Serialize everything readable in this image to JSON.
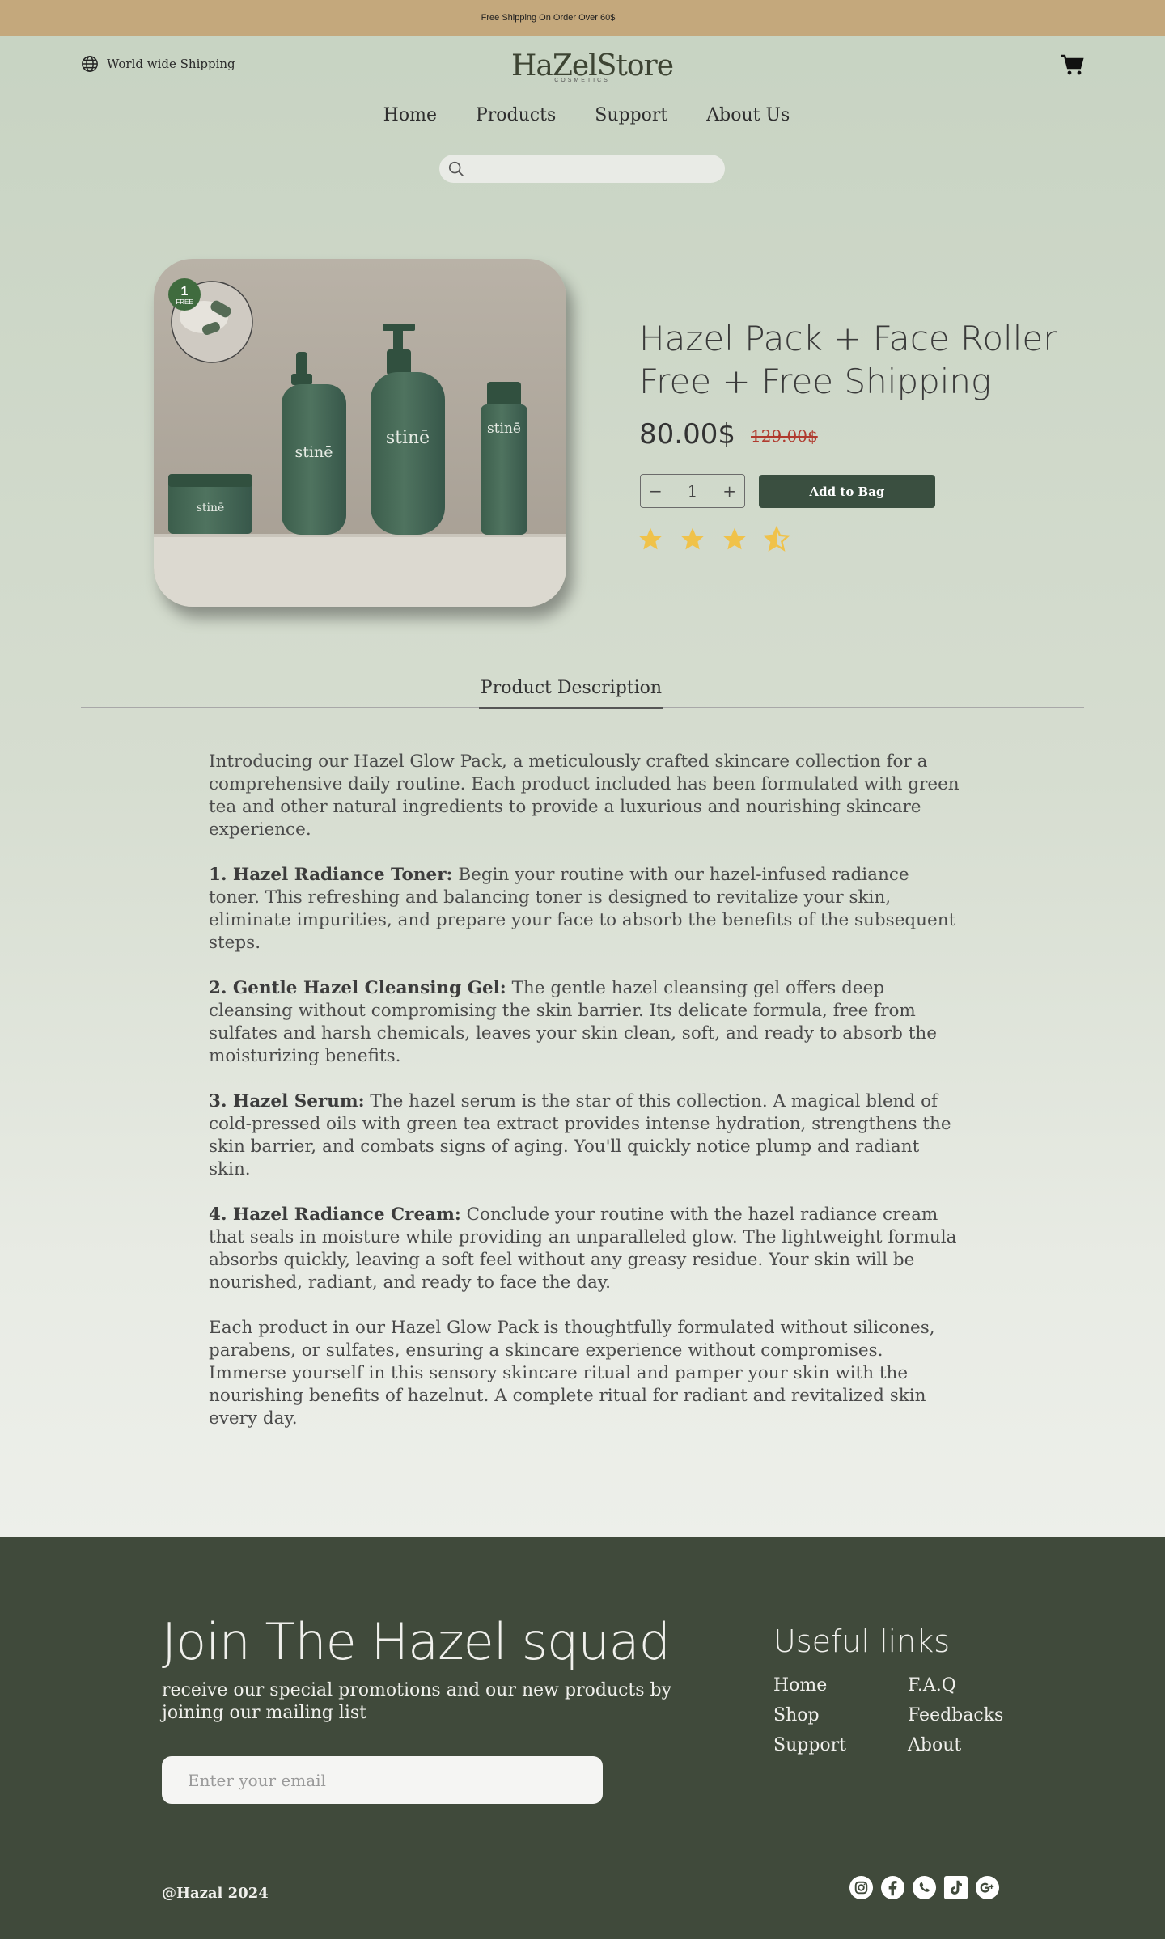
{
  "announcement": "Free Shipping On Order Over 60$",
  "header": {
    "shipping_label": "World wide Shipping",
    "logo_name": "HaZelStore",
    "logo_sub": "COSMETICS"
  },
  "nav": [
    "Home",
    "Products",
    "Support",
    "About Us"
  ],
  "search": {
    "placeholder": ""
  },
  "product": {
    "title": "Hazel Pack + Face Roller Free + Free Shipping",
    "price": "80.00$",
    "old_price": "129.00$",
    "quantity": "1",
    "minus": "−",
    "plus": "+",
    "add_to_bag": "Add to Bag",
    "rating": 3.5,
    "badge_number": "1",
    "badge_text": "FREE",
    "brand_label": "stinē"
  },
  "tabs": {
    "description": "Product Description"
  },
  "description": {
    "intro": "Introducing our Hazel Glow Pack, a meticulously crafted skincare collection for a comprehensive daily routine. Each product included has been formulated with green tea and other natural ingredients to provide a luxurious and nourishing skincare experience.",
    "items": [
      {
        "heading": "1. Hazel Radiance Toner:",
        "text": " Begin your routine with our hazel-infused radiance toner. This refreshing and balancing toner is designed to revitalize your skin, eliminate impurities, and prepare your face to absorb the benefits of the subsequent steps."
      },
      {
        "heading": "2. Gentle Hazel Cleansing Gel:",
        "text": " The gentle hazel cleansing gel offers deep cleansing without compromising the skin barrier. Its delicate formula, free from sulfates and harsh chemicals, leaves your skin clean, soft, and ready to absorb the moisturizing benefits."
      },
      {
        "heading": "3. Hazel Serum:",
        "text": " The hazel serum is the star of this collection. A magical blend of cold-pressed oils with green tea extract provides intense hydration, strengthens the skin barrier, and combats signs of aging. You'll quickly notice plump and radiant skin."
      },
      {
        "heading": "4. Hazel Radiance Cream:",
        "text": " Conclude your routine with the hazel radiance cream that seals in moisture while providing an unparalleled glow. The lightweight formula absorbs quickly, leaving a soft feel without any greasy residue. Your skin will be nourished, radiant, and ready to face the day."
      }
    ],
    "outro": "Each product in our Hazel Glow Pack is thoughtfully formulated without silicones, parabens, or sulfates, ensuring a skincare experience without compromises. Immerse yourself in this sensory skincare ritual and pamper your skin with the nourishing benefits of hazelnut. A complete ritual for radiant and revitalized skin every day."
  },
  "footer": {
    "join_title": "Join The Hazel squad",
    "join_sub": "receive our special promotions and our new products by joining our mailing list",
    "email_placeholder": "Enter your email",
    "links_title": "Useful links",
    "links": [
      "Home",
      "F.A.Q",
      "Shop",
      "Feedbacks",
      "Support",
      "About"
    ],
    "copyright": "@Hazal 2024",
    "social": [
      "instagram-icon",
      "facebook-icon",
      "whatsapp-icon",
      "tiktok-icon",
      "google-plus-icon"
    ]
  },
  "colors": {
    "announcement_bg": "#c4a87c",
    "accent": "#3a4f40",
    "footer_bg": "#404a3b",
    "star": "#f0c24a",
    "old_price": "#b03a2e"
  }
}
